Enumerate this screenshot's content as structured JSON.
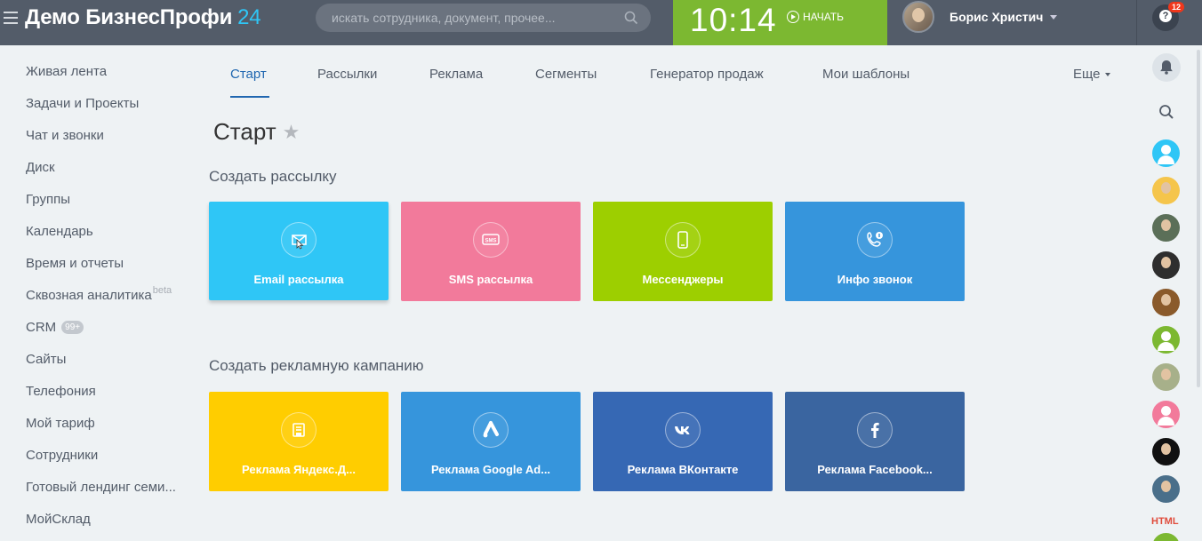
{
  "header": {
    "logo_text": "Демо БизнесПрофи",
    "logo_num": "24",
    "search_placeholder": "искать сотрудника, документ, прочее...",
    "clock": "10:14",
    "start_label": "НАЧАТЬ",
    "user_name": "Борис Христич",
    "help_badge": "12"
  },
  "sidebar": {
    "items": [
      {
        "label": "Живая лента"
      },
      {
        "label": "Задачи и Проекты"
      },
      {
        "label": "Чат и звонки"
      },
      {
        "label": "Диск"
      },
      {
        "label": "Группы"
      },
      {
        "label": "Календарь"
      },
      {
        "label": "Время и отчеты"
      },
      {
        "label": "Сквозная аналитика",
        "sup": "beta"
      },
      {
        "label": "CRM",
        "counter": "99+"
      },
      {
        "label": "Сайты"
      },
      {
        "label": "Телефония"
      },
      {
        "label": "Мой тариф"
      },
      {
        "label": "Сотрудники"
      },
      {
        "label": "Готовый лендинг семи..."
      },
      {
        "label": "МойСклад"
      }
    ]
  },
  "tabs": {
    "items": [
      "Старт",
      "Рассылки",
      "Реклама",
      "Сегменты",
      "Генератор продаж",
      "Мои шаблоны"
    ],
    "more": "Еще"
  },
  "page": {
    "title": "Старт",
    "section1": "Создать рассылку",
    "section2": "Создать рекламную кампанию"
  },
  "mailing_tiles": [
    {
      "label": "Email рассылка",
      "icon": "email-icon",
      "color": "#2fc6f6"
    },
    {
      "label": "SMS рассылка",
      "icon": "sms-icon",
      "color": "#f27a9b"
    },
    {
      "label": "Мессенджеры",
      "icon": "phone-icon",
      "color": "#9dcf00"
    },
    {
      "label": "Инфо звонок",
      "icon": "call-info-icon",
      "color": "#3695dc"
    }
  ],
  "ad_tiles": [
    {
      "label": "Реклама Яндекс.Д...",
      "icon": "yandex-direct-icon",
      "color": "#ffcd00"
    },
    {
      "label": "Реклама Google Ad...",
      "icon": "google-ads-icon",
      "color": "#3695dc"
    },
    {
      "label": "Реклама ВКонтакте",
      "icon": "vk-icon",
      "color": "#3668b4"
    },
    {
      "label": "Реклама Facebook...",
      "icon": "facebook-icon",
      "color": "#3a65a0"
    }
  ],
  "right_panel": {
    "html_tag": "HTML"
  }
}
